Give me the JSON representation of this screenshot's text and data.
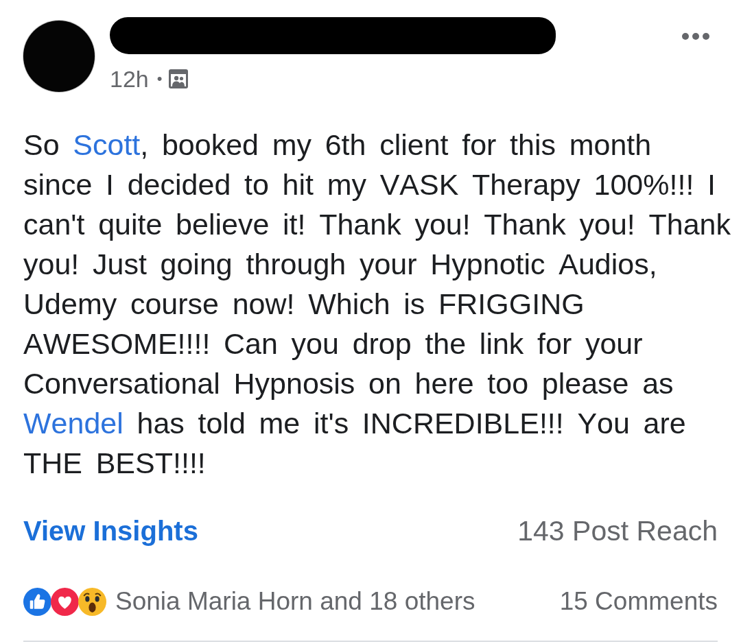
{
  "post": {
    "header": {
      "time": "12h",
      "separator": "•"
    },
    "body": [
      {
        "kind": "text",
        "text": "So "
      },
      {
        "kind": "mention",
        "text": "Scott"
      },
      {
        "kind": "text",
        "text": ", booked my 6th client for this month since I decided to hit my VASK Therapy 100%!!! I can't quite believe it! Thank you! Thank you! Thank you! Just going through your Hypnotic Audios, Udemy course now! Which is FRIGGING AWESOME!!!! Can you drop the link for your Conversational Hypnosis on here too please as "
      },
      {
        "kind": "mention",
        "text": "Wendel"
      },
      {
        "kind": "text",
        "text": " has told me it's INCREDIBLE!!! You are THE BEST!!!!"
      }
    ],
    "insights": {
      "link": "View Insights",
      "reach": "143 Post Reach"
    },
    "reactions": {
      "summary": "Sonia Maria Horn and 18 others",
      "comments": "15 Comments"
    }
  }
}
